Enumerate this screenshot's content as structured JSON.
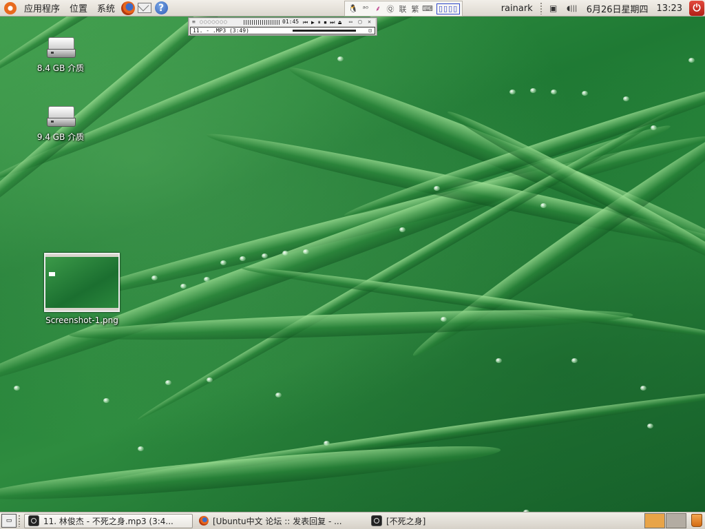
{
  "top_panel": {
    "menus": [
      "应用程序",
      "位置",
      "系统"
    ],
    "launchers": {
      "browser_icon": "firefox-icon",
      "mail_icon": "mail-icon",
      "help_glyph": "?"
    },
    "tray": {
      "icons": [
        "qq-penguin-icon",
        "network-status-icon",
        "feather-icon",
        "search-icon",
        "link-icon",
        "contact-icon",
        "keyboard-icon"
      ],
      "glyphs": [
        "🐧",
        "ᵃᵒ",
        "⸙",
        "Ⓠ",
        "联",
        "繁",
        "⌨"
      ],
      "ime_label": "▯▯▯▯"
    },
    "user": "rainark",
    "date": "6月26日星期四",
    "time": "13:23",
    "network_glyph": "▣",
    "volume_glyph": "◖|||"
  },
  "player": {
    "time": "01:45",
    "title": "11.    -     .MP3 (3:49)",
    "controls": "⏮ ▶ ⏸ ⏹ ⏭ ⏏",
    "window_controls": "▭ ▢ ✕",
    "lock_glyph": "⊡"
  },
  "desktop": {
    "icons": [
      {
        "label": "8.4 GB 介质"
      },
      {
        "label": "9.4 GB 介质"
      },
      {
        "label": "Screenshot-1.png"
      }
    ]
  },
  "bottom_panel": {
    "show_desktop_glyph": "▭",
    "tasks": [
      {
        "label": "11. 林俊杰 - 不死之身.mp3 (3:4...",
        "active": true
      },
      {
        "label": "[Ubuntu中文 论坛 :: 发表回复 - ...",
        "active": false
      },
      {
        "label": "[不死之身]",
        "active": false
      }
    ],
    "workspaces": [
      {
        "color": "#e8a448"
      },
      {
        "color": "#b3aca2"
      }
    ]
  }
}
